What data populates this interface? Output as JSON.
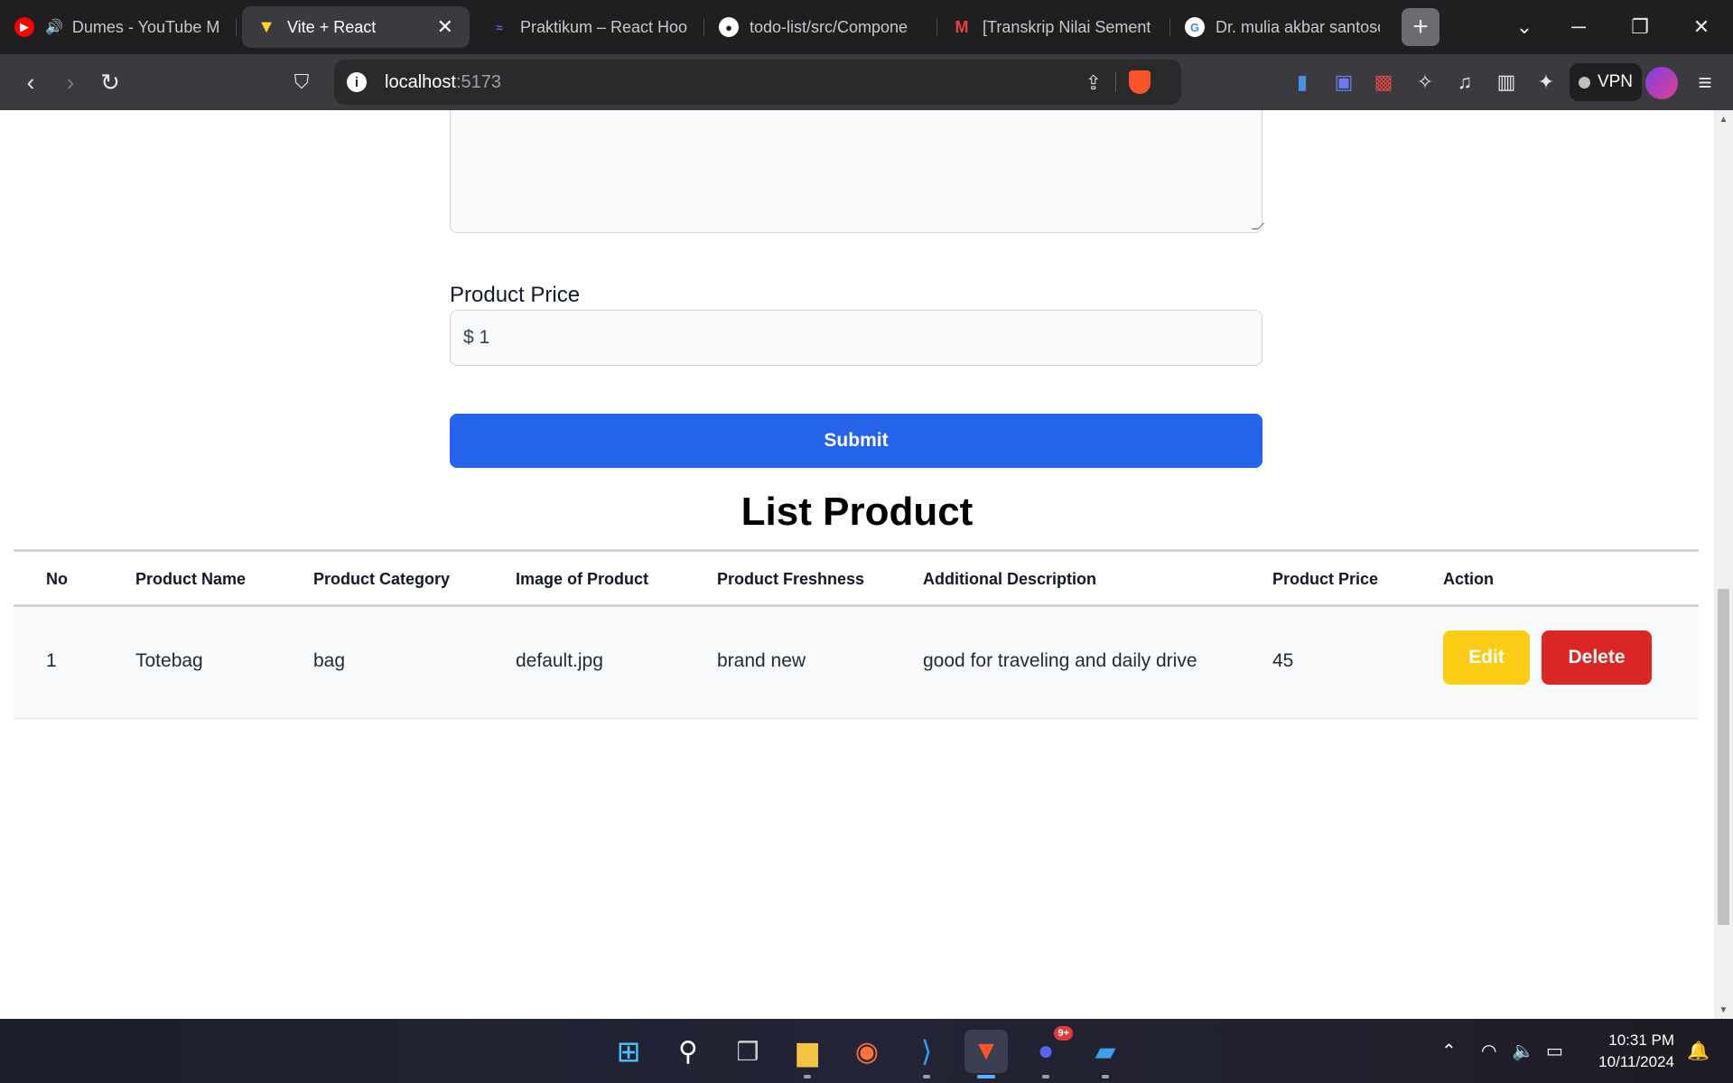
{
  "browser": {
    "tabs": [
      {
        "title": "Dumes - YouTube M",
        "favicon": "youtube-music-icon",
        "audio": true,
        "active": false
      },
      {
        "title": "Vite + React",
        "favicon": "vite-icon",
        "active": true
      },
      {
        "title": "Praktikum – React Hook",
        "favicon": "praktikum-icon",
        "active": false
      },
      {
        "title": "todo-list/src/Compone",
        "favicon": "github-icon",
        "active": false
      },
      {
        "title": "[Transkrip Nilai Sement",
        "favicon": "gmail-icon",
        "active": false
      },
      {
        "title": "Dr. mulia akbar santoso",
        "favicon": "google-icon",
        "active": false
      }
    ],
    "new_tab_label": "+",
    "url_host": "localhost",
    "url_port": ":5173",
    "vpn_label": "VPN"
  },
  "form": {
    "price_label": "Product Price",
    "price_value": "$ 1",
    "submit_label": "Submit"
  },
  "list": {
    "title": "List Product",
    "columns": [
      "No",
      "Product Name",
      "Product Category",
      "Image of Product",
      "Product Freshness",
      "Additional Description",
      "Product Price",
      "Action"
    ],
    "rows": [
      {
        "no": "1",
        "name": "Totebag",
        "category": "bag",
        "image": "default.jpg",
        "freshness": "brand new",
        "description": "good for traveling and daily drive",
        "price": "45",
        "edit_label": "Edit",
        "delete_label": "Delete"
      }
    ]
  },
  "taskbar": {
    "apps": [
      "windows-start-icon",
      "search-icon",
      "task-view-icon",
      "file-explorer-icon",
      "firefox-icon",
      "vscode-icon",
      "brave-icon",
      "discord-icon",
      "photos-icon"
    ],
    "discord_badge": "9+",
    "time": "10:31 PM",
    "date": "10/11/2024"
  },
  "colors": {
    "submit_blue": "#2563eb",
    "edit_yellow": "#facc15",
    "delete_red": "#dc2626",
    "chrome_dark": "#1f1f22",
    "toolbar": "#3b3b3f"
  }
}
